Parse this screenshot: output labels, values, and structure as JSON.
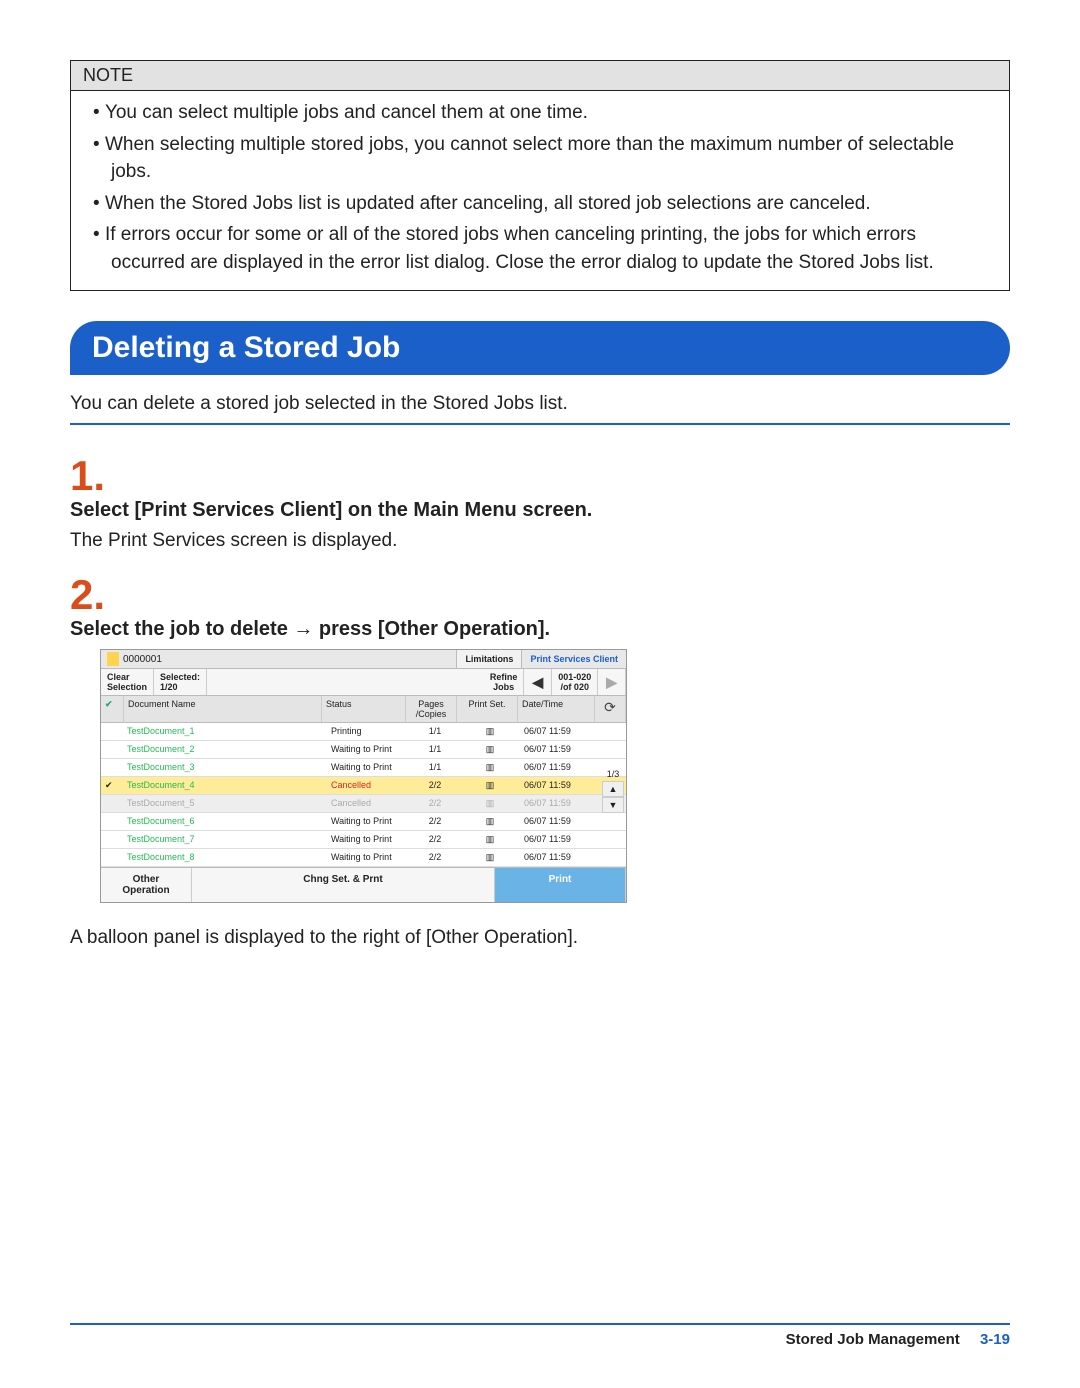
{
  "note": {
    "title": "NOTE",
    "items": [
      "You can select multiple jobs and cancel them at one time.",
      "When selecting multiple stored jobs, you cannot select more than the maximum number of selectable jobs.",
      "When the Stored Jobs list is updated after canceling, all stored job selections are canceled.",
      "If errors occur for some or all of the stored jobs when canceling printing, the jobs for which errors occurred are displayed in the error list dialog. Close the error dialog to update the Stored Jobs list."
    ]
  },
  "heading": "Deleting a Stored Job",
  "intro": "You can delete a stored job selected in the Stored Jobs list.",
  "steps": [
    {
      "num": "1.",
      "title": "Select [Print Services Client] on the Main Menu screen.",
      "desc": "The Print Services screen is displayed."
    },
    {
      "num": "2.",
      "title": "Select the job to delete → press [Other Operation].",
      "desc": ""
    }
  ],
  "screenshot": {
    "user": "0000001",
    "limitations": "Limitations",
    "branding": "Print Services Client",
    "toolbar": {
      "clear1": "Clear",
      "clear2": "Selection",
      "selected1": "Selected:",
      "selected2": "1/20",
      "refine1": "Refine",
      "refine2": "Jobs",
      "prev": "◀",
      "range1": "001-020",
      "range2": "/of 020",
      "next": "▶"
    },
    "columns": {
      "name": "Document Name",
      "status": "Status",
      "pages": "Pages /Copies",
      "pset": "Print Set.",
      "dt": "Date/Time",
      "refresh": "⟳"
    },
    "rows": [
      {
        "check": "",
        "name": "TestDocument_1",
        "status": "Printing",
        "pages": "1/1",
        "dt": "06/07 11:59",
        "hl": false,
        "cancel": false,
        "gray": false
      },
      {
        "check": "",
        "name": "TestDocument_2",
        "status": "Waiting to Print",
        "pages": "1/1",
        "dt": "06/07 11:59",
        "hl": false,
        "cancel": false,
        "gray": false
      },
      {
        "check": "",
        "name": "TestDocument_3",
        "status": "Waiting to Print",
        "pages": "1/1",
        "dt": "06/07 11:59",
        "hl": false,
        "cancel": false,
        "gray": false
      },
      {
        "check": "✔",
        "name": "TestDocument_4",
        "status": "Cancelled",
        "pages": "2/2",
        "dt": "06/07 11:59",
        "hl": true,
        "cancel": true,
        "gray": false
      },
      {
        "check": "",
        "name": "TestDocument_5",
        "status": "Cancelled",
        "pages": "2/2",
        "dt": "06/07 11:59",
        "hl": false,
        "cancel": false,
        "gray": true
      },
      {
        "check": "",
        "name": "TestDocument_6",
        "status": "Waiting to Print",
        "pages": "2/2",
        "dt": "06/07 11:59",
        "hl": false,
        "cancel": false,
        "gray": false
      },
      {
        "check": "",
        "name": "TestDocument_7",
        "status": "Waiting to Print",
        "pages": "2/2",
        "dt": "06/07 11:59",
        "hl": false,
        "cancel": false,
        "gray": false
      },
      {
        "check": "",
        "name": "TestDocument_8",
        "status": "Waiting to Print",
        "pages": "2/2",
        "dt": "06/07 11:59",
        "hl": false,
        "cancel": false,
        "gray": false
      }
    ],
    "sidebar_counter": "1/3",
    "bottom": {
      "other": "Other Operation",
      "chng": "Chng Set. & Prnt",
      "print": "Print"
    }
  },
  "after_screenshot": "A balloon panel is displayed to the right of [Other Operation].",
  "footer": {
    "section": "Stored Job Management",
    "page": "3-19"
  }
}
